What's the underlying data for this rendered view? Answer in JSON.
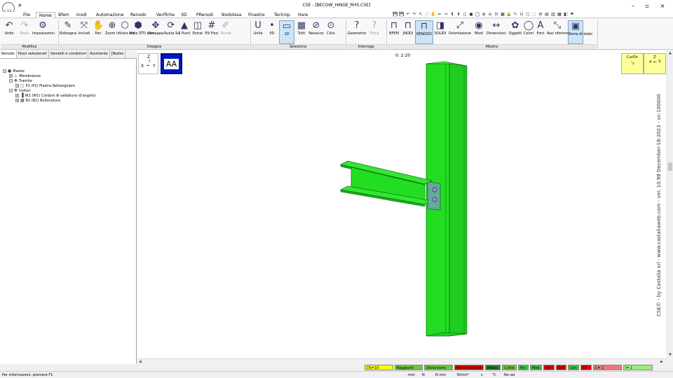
{
  "titlebar": {
    "title": "CSE - [BECOW_HINGE_RHS.CSE]",
    "logo": "C.S.E.",
    "quick_icon": "¤",
    "minimize": "–",
    "maximize": "▫",
    "close": "×"
  },
  "menu": {
    "tabs": [
      "File",
      "Home",
      "Bfem",
      "Inodi",
      "Automazione",
      "Renodo",
      "Verifiche",
      "3D",
      "PRenodi",
      "Nodotesa",
      "Finestre",
      "Technip",
      "Hare"
    ],
    "active": "Home"
  },
  "quick_toolbar": [
    "💾",
    "💾",
    "↶",
    "↷",
    "✎",
    "📄",
    "✋",
    "⇐",
    "⇒",
    "⬆",
    "⬇",
    "◻",
    "◼",
    "◯",
    "⊕",
    "⊖",
    "⊡",
    "▦",
    "🔒",
    "✎",
    "U",
    "▢",
    "⬚",
    "⚙",
    "▤",
    "▥",
    "▦",
    "◧",
    "⚑"
  ],
  "ribbon": {
    "groups": [
      {
        "label": "Modifica",
        "buttons": [
          {
            "icon": "↶",
            "label": "Undo"
          },
          {
            "icon": "↷",
            "label": "Redo",
            "disabled": true
          },
          {
            "icon": "⚙",
            "label": "Impostazioni"
          }
        ]
      },
      {
        "label": "Disegna",
        "buttons": [
          {
            "icon": "✎",
            "label": "Ridisegna"
          },
          {
            "icon": "⤧",
            "label": "Includi"
          },
          {
            "icon": "✋",
            "label": "Pan"
          },
          {
            "icon": "⊕",
            "label": "Zoom In"
          },
          {
            "icon": "⬡",
            "label": "Vista std"
          },
          {
            "icon": "⬢",
            "label": "Vista STD com."
          },
          {
            "icon": "✥",
            "label": "Rimappa"
          },
          {
            "icon": "⟳",
            "label": "Ruota Su"
          },
          {
            "icon": "▲",
            "label": "3 Punti"
          },
          {
            "icon": "◫",
            "label": "Estrai"
          },
          {
            "icon": "#",
            "label": "Fili Fissi"
          },
          {
            "icon": "✐",
            "label": "Tavole",
            "disabled": true
          }
        ]
      },
      {
        "label": "Seleziona",
        "buttons": [
          {
            "icon": "U",
            "label": "Unità"
          },
          {
            "icon": "•",
            "label": "0D"
          },
          {
            "icon": "▭",
            "label": "1D",
            "selected": true
          },
          {
            "icon": "▦",
            "label": "Tutti"
          },
          {
            "icon": "⊘",
            "label": "Nessuno"
          },
          {
            "icon": "⊙",
            "label": "Click"
          }
        ]
      },
      {
        "label": "Interroga",
        "buttons": [
          {
            "icon": "?",
            "label": "Geometria"
          },
          {
            "icon": "?",
            "label": "Trova",
            "disabled": true
          }
        ]
      },
      {
        "label": "Mostra",
        "buttons": [
          {
            "icon": "⊓",
            "label": "BFEM"
          },
          {
            "icon": "⊓",
            "label": "JNODI"
          },
          {
            "icon": "⊓",
            "label": "RENODO",
            "selected": true
          },
          {
            "icon": "◨",
            "label": "SOLIDI"
          },
          {
            "icon": "⤢",
            "label": "Orientazione"
          },
          {
            "icon": "◉",
            "label": "Modi"
          },
          {
            "icon": "↔",
            "label": "Dimensioni"
          },
          {
            "icon": "✿",
            "label": "Oggetti"
          },
          {
            "icon": "◯",
            "label": "Colori"
          },
          {
            "icon": "A",
            "label": "Font"
          },
          {
            "icon": "⤡",
            "label": "Assi riferimento"
          },
          {
            "icon": "▣",
            "label": "Barra di stato",
            "selected": true
          }
        ]
      }
    ]
  },
  "left_panel": {
    "tabs": [
      "Renodo",
      "Pezzi selezionati",
      "Variabili e condizioni",
      "Assistente",
      "JNodes"
    ],
    "active_tab": "Renodo",
    "tree": [
      {
        "level": 0,
        "exp": "−",
        "icon": "●",
        "label": "Master"
      },
      {
        "level": 1,
        "exp": "+",
        "icon": "⊥",
        "label": "Membrature"
      },
      {
        "level": 1,
        "exp": "−",
        "icon": "✤",
        "label": "Tramite"
      },
      {
        "level": 2,
        "exp": "+",
        "icon": "▢",
        "label": "P1 (P1)  Piastra Rettangolare"
      },
      {
        "level": 1,
        "exp": "−",
        "icon": "✤",
        "label": "Unitori"
      },
      {
        "level": 2,
        "exp": "+",
        "icon": "▐",
        "label": "W1 (W1)  Cordoni di saldatura (d'angolo)"
      },
      {
        "level": 2,
        "exp": "+",
        "icon": "▦",
        "label": "B1 (B1)  Bullonatura"
      }
    ]
  },
  "viewport": {
    "axis_z": "Z",
    "axis_x": "X",
    "axis_y": "Y",
    "view_label": "AA",
    "coord_readout": "0: 2:20",
    "corner_left_label": "CurDir",
    "corner_right_label": "Z",
    "credit": "CSE© - by Castalia srl - www.castaliaweb.com - ver. 10.98 December-18-2023 - sn:100000",
    "model_color": "#22dd22",
    "model_stroke": "#0a5a0a"
  },
  "filter_chips": [
    {
      "label": "DS=10",
      "color": "#ffff00"
    },
    {
      "label": "Raggiunti",
      "color": "#66cc33"
    },
    {
      "label": "Distorsione",
      "color": "#66cc33"
    },
    {
      "label": "Compressione",
      "color": "#dd0000"
    },
    {
      "label": "Rilievi",
      "color": "#228822"
    },
    {
      "label": "Collisi",
      "color": "#66cc33"
    },
    {
      "label": "Fin",
      "color": "#33cc33"
    },
    {
      "label": "Med",
      "color": "#33cc33"
    },
    {
      "label": "Tor",
      "color": "#dd0000"
    },
    {
      "label": "Cal",
      "color": "#dd0000"
    },
    {
      "label": "Cen",
      "color": "#33cc33"
    },
    {
      "label": "Ct",
      "color": "#dd0000"
    },
    {
      "label": "C= 1",
      "color": "#ee7777"
    },
    {
      "label": "I= 1",
      "color": "#99ee77"
    }
  ],
  "statusbar": {
    "message": "Per informazioni, premere F1",
    "units": [
      "mm",
      "N",
      "N mm",
      "N/mm²",
      "s",
      "°C",
      "No sel"
    ]
  }
}
